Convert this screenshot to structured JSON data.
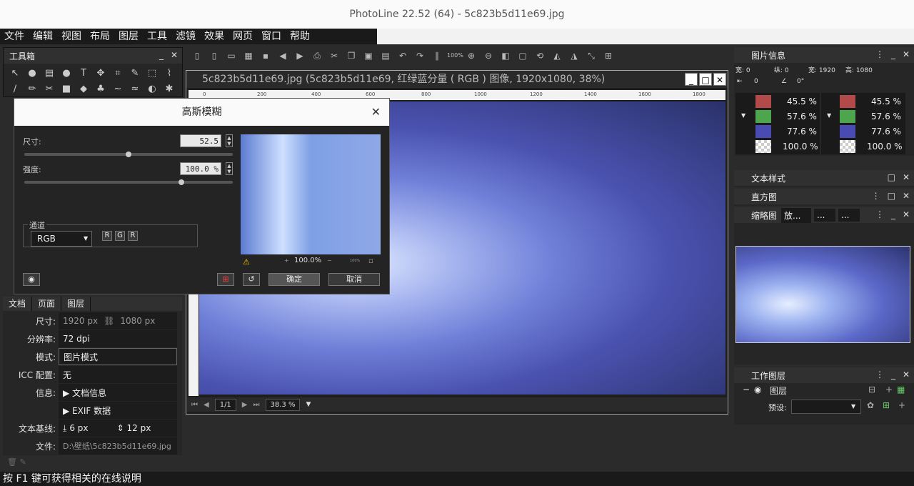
{
  "window": {
    "title": "PhotoLine 22.52 (64) - 5c823b5d11e69.jpg"
  },
  "menu": [
    "文件",
    "编辑",
    "视图",
    "布局",
    "图层",
    "工具",
    "滤镜",
    "效果",
    "网页",
    "窗口",
    "帮助"
  ],
  "toolbox": {
    "title": "工具箱"
  },
  "document": {
    "title": "5c823b5d11e69.jpg (5c823b5d11e69, 红绿蓝分量 ( RGB ) 图像, 1920x1080, 38%)",
    "ruler_ticks": [
      "0",
      "200",
      "400",
      "600",
      "800",
      "1000",
      "1200",
      "1400",
      "1600",
      "1800"
    ],
    "page": "1/1",
    "zoom": "38.3 %"
  },
  "dialog": {
    "title": "高斯模糊",
    "size_label": "尺寸:",
    "size_value": "52.5",
    "size_level": 0.5,
    "strength_label": "强度:",
    "strength_value": "100.0 %",
    "strength_level": 0.76,
    "channel_label": "通道",
    "channel_select": "RGB",
    "channel_buttons": [
      "R",
      "G",
      "R"
    ],
    "preview_zoom": "100.0%",
    "preview_mini": "100%",
    "ok_label": "确定",
    "cancel_label": "取消"
  },
  "docpanel": {
    "tabs": [
      "文档",
      "页面",
      "图层"
    ],
    "size_label": "尺寸:",
    "width": "1920 px",
    "height": "1080 px",
    "resolution_label": "分辨率:",
    "resolution": "72 dpi",
    "mode_label": "模式:",
    "mode": "图片模式",
    "icc_label": "ICC 配置:",
    "icc": "无",
    "info_label": "信息:",
    "doc_info": "▶ 文档信息",
    "exif": "▶ EXIF 数据",
    "baseline_label": "文本基线:",
    "baseline1": "6 px",
    "baseline2": "12 px",
    "file_label": "文件:",
    "file": "D:\\壁纸\\5c823b5d11e69.jpg"
  },
  "imageinfo": {
    "title": "图片信息",
    "x": "宽: 0",
    "y": "纵: 0",
    "w": "宽: 1920",
    "h": "高: 1080",
    "dist": "0",
    "angle": "0°",
    "left_values": [
      "45.5 %",
      "57.6 %",
      "77.6 %",
      "100.0 %"
    ],
    "right_values": [
      "45.5 %",
      "57.6 %",
      "77.6 %",
      "100.0 %"
    ],
    "swatch_colors": [
      "#b34a4a",
      "#4da64d",
      "#4a4ab3",
      "#ffffff"
    ]
  },
  "textstyle": {
    "title": "文本样式"
  },
  "histogram": {
    "title": "直方图"
  },
  "thumbnail": {
    "title": "缩略图",
    "tab1": "放...",
    "tab2": "...",
    "tab3": "..."
  },
  "worklayers": {
    "title": "工作图层",
    "layer": "图层",
    "preset_label": "预设:"
  },
  "status": {
    "text": "按 F1 键可获得相关的在线说明"
  }
}
